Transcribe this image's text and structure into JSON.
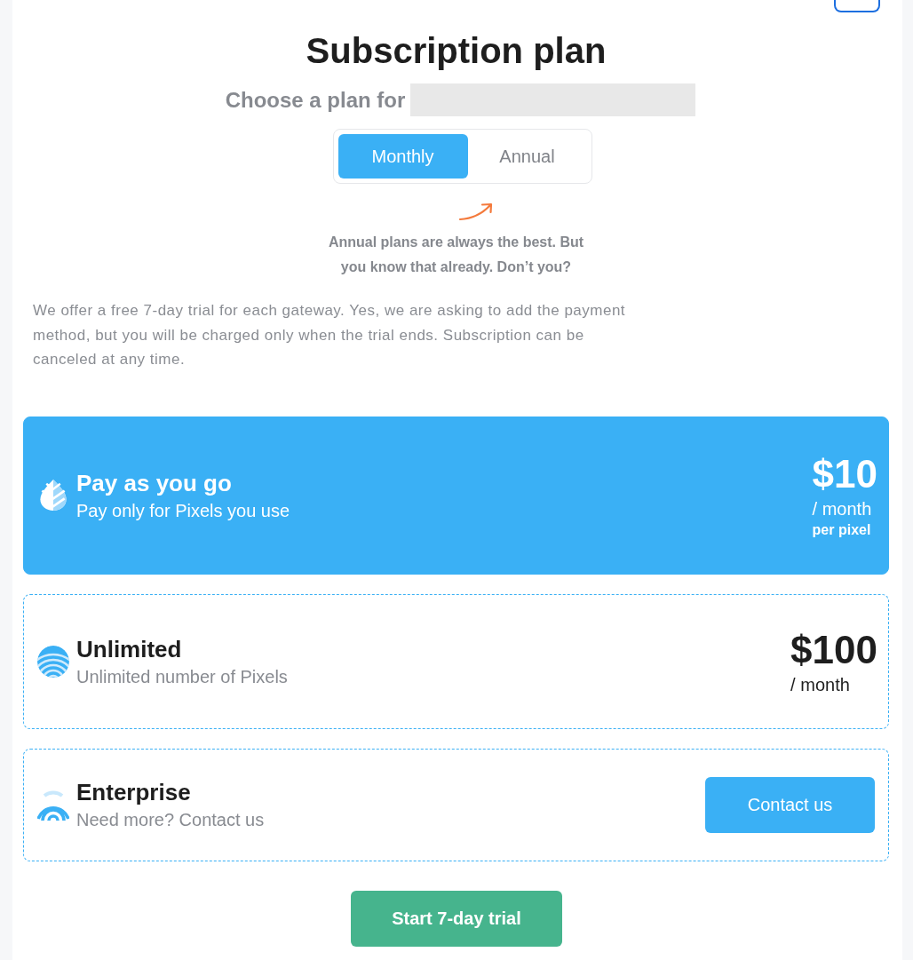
{
  "header": {
    "title": "Subscription plan",
    "subtitle": "Choose a plan for"
  },
  "billing_toggle": [
    {
      "label": "Monthly",
      "selected": true
    },
    {
      "label": "Annual",
      "selected": false
    }
  ],
  "hint": "Annual plans are always the best. But you know that already. Don’t you?",
  "trial_note": "We offer a free 7-day trial for each gateway. Yes, we are asking to add the payment method, but you will be charged only when the trial ends. Subscription can be canceled at any time.",
  "plans": [
    {
      "kind": "price",
      "title": "Pay as you go",
      "subtitle": "Pay only for Pixels you use",
      "price": "$10",
      "period": "/ month",
      "note": "per pixel",
      "selected": true
    },
    {
      "kind": "price",
      "title": "Unlimited",
      "subtitle": "Unlimited number of Pixels",
      "price": "$100",
      "period": "/ month",
      "selected": false
    },
    {
      "kind": "contact",
      "title": "Enterprise",
      "subtitle": "Need more? Contact us",
      "button": "Contact us",
      "selected": false
    }
  ],
  "trial_button": "Start 7-day trial"
}
